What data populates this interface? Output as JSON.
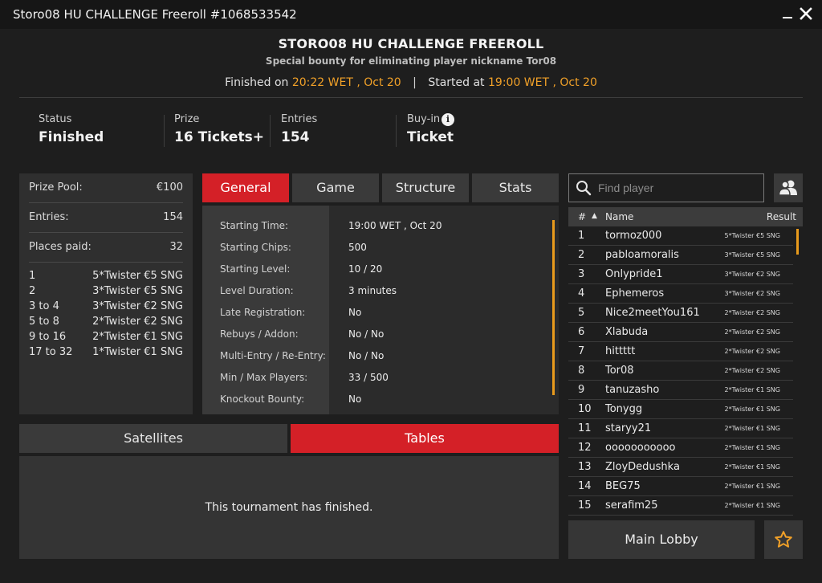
{
  "window": {
    "title": "Storo08 HU CHALLENGE Freeroll #1068533542"
  },
  "header": {
    "title": "STORO08 HU CHALLENGE FREEROLL",
    "subtitle": "Special bounty for eliminating player nickname Tor08",
    "finished_label": "Finished on",
    "finished_time": "20:22 WET , Oct 20",
    "separator": "|",
    "started_label": "Started at",
    "started_time": "19:00 WET , Oct 20"
  },
  "info": {
    "status_label": "Status",
    "status_value": "Finished",
    "prize_label": "Prize",
    "prize_value": "16 Tickets+",
    "entries_label": "Entries",
    "entries_value": "154",
    "buyin_label": "Buy-in",
    "buyin_value": "Ticket"
  },
  "prize_panel": {
    "pool_label": "Prize Pool:",
    "pool_value": "€100",
    "entries_label": "Entries:",
    "entries_value": "154",
    "paid_label": "Places paid:",
    "paid_value": "32",
    "places": [
      {
        "place": "1",
        "prize": "5*Twister €5 SNG"
      },
      {
        "place": "2",
        "prize": "3*Twister €5 SNG"
      },
      {
        "place": "3  to  4",
        "prize": "3*Twister €2 SNG"
      },
      {
        "place": "5  to  8",
        "prize": "2*Twister €2 SNG"
      },
      {
        "place": "9  to  16",
        "prize": "2*Twister €1 SNG"
      },
      {
        "place": "17  to  32",
        "prize": "1*Twister €1 SNG"
      }
    ]
  },
  "tabs": [
    "General",
    "Game",
    "Structure",
    "Stats"
  ],
  "general": [
    {
      "label": "Starting Time:",
      "value": "19:00 WET , Oct 20"
    },
    {
      "label": "Starting Chips:",
      "value": "500"
    },
    {
      "label": "Starting Level:",
      "value": "10 / 20"
    },
    {
      "label": "Level Duration:",
      "value": "3 minutes"
    },
    {
      "label": "Late Registration:",
      "value": "No"
    },
    {
      "label": "Rebuys / Addon:",
      "value": "No / No"
    },
    {
      "label": "Multi-Entry / Re-Entry:",
      "value": "No / No"
    },
    {
      "label": "Min / Max Players:",
      "value": "33 / 500"
    },
    {
      "label": "Knockout Bounty:",
      "value": "No"
    }
  ],
  "bottom_tabs": [
    "Satellites",
    "Tables"
  ],
  "finished_message": "This tournament has finished.",
  "search": {
    "placeholder": "Find player"
  },
  "players": {
    "col_num": "#",
    "col_sort": "▲",
    "col_name": "Name",
    "col_result": "Result",
    "rows": [
      {
        "n": "1",
        "name": "tormoz000",
        "result": "5*Twister €5 SNG"
      },
      {
        "n": "2",
        "name": "pabloamoralis",
        "result": "3*Twister €5 SNG"
      },
      {
        "n": "3",
        "name": "Onlypride1",
        "result": "3*Twister €2 SNG"
      },
      {
        "n": "4",
        "name": "Ephemeros",
        "result": "3*Twister €2 SNG"
      },
      {
        "n": "5",
        "name": "Nice2meetYou161",
        "result": "2*Twister €2 SNG"
      },
      {
        "n": "6",
        "name": "Xlabuda",
        "result": "2*Twister €2 SNG"
      },
      {
        "n": "7",
        "name": "hittttt",
        "result": "2*Twister €2 SNG"
      },
      {
        "n": "8",
        "name": "Tor08",
        "result": "2*Twister €2 SNG"
      },
      {
        "n": "9",
        "name": "tanuzasho",
        "result": "2*Twister €1 SNG"
      },
      {
        "n": "10",
        "name": "Tonygg",
        "result": "2*Twister €1 SNG"
      },
      {
        "n": "11",
        "name": "staryy21",
        "result": "2*Twister €1 SNG"
      },
      {
        "n": "12",
        "name": "ooooooooooo",
        "result": "2*Twister €1 SNG"
      },
      {
        "n": "13",
        "name": "ZloyDedushka",
        "result": "2*Twister €1 SNG"
      },
      {
        "n": "14",
        "name": "BEG75",
        "result": "2*Twister €1 SNG"
      },
      {
        "n": "15",
        "name": "serafim25",
        "result": "2*Twister €1 SNG"
      }
    ]
  },
  "main_lobby_label": "Main Lobby",
  "colors": {
    "accent_red": "#d42027",
    "accent_orange": "#f0a028",
    "background": "#1e1e1e"
  }
}
